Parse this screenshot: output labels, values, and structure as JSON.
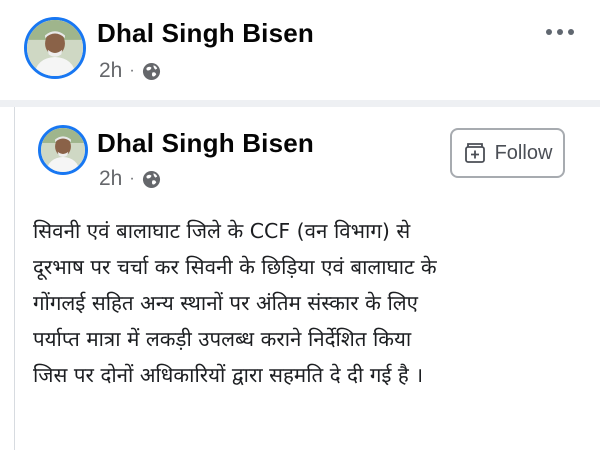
{
  "outer_post": {
    "author": "Dhal Singh Bisen",
    "time": "2h",
    "separator": "·",
    "privacy_icon": "globe-icon",
    "menu_icon": "more-options-icon"
  },
  "shared_post": {
    "author": "Dhal Singh Bisen",
    "time": "2h",
    "separator": "·",
    "privacy_icon": "globe-icon",
    "follow_label": "Follow",
    "follow_icon": "follow-page-icon",
    "text_lines": [
      "सिवनी एवं बालाघाट जिले के CCF (वन विभाग) से",
      "दूरभाष पर चर्चा कर सिवनी के छिड़िया एवं बालाघाट के",
      "गोंगलई सहित अन्य स्थानों पर अंतिम संस्कार के लिए",
      "पर्याप्त मात्रा में लकड़ी उपलब्ध कराने निर्देशित किया",
      "जिस पर दोनों अधिकारियों द्वारा सहमति दे दी गई है ।"
    ]
  },
  "colors": {
    "accent": "#1877f2",
    "meta_text": "#65676b",
    "divider": "#eef0f3"
  }
}
